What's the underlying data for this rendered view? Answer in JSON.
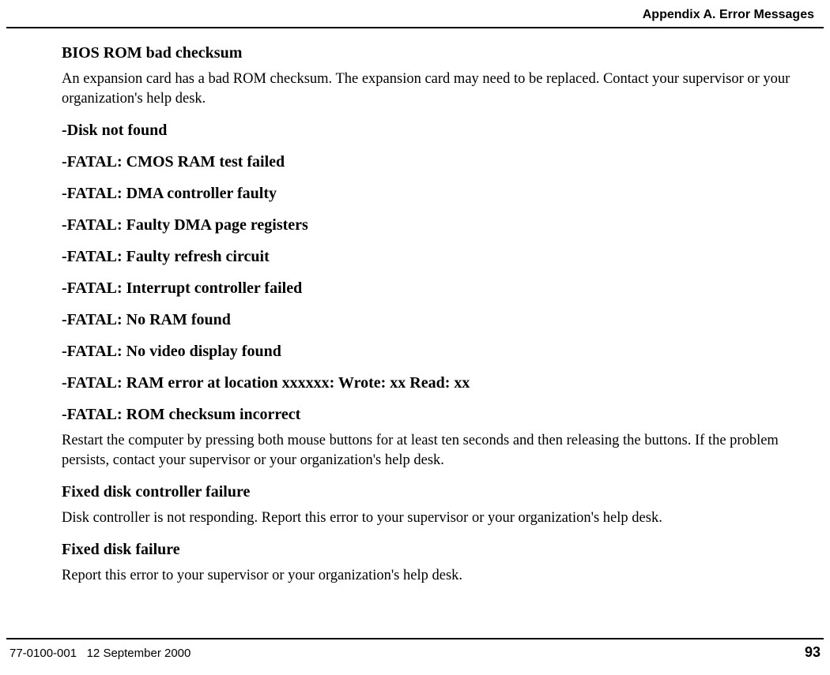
{
  "header": {
    "title": "Appendix A. Error Messages"
  },
  "sections": [
    {
      "heading": "BIOS ROM bad checksum",
      "body": "An expansion card has a bad ROM checksum. The expansion card may need to be replaced. Contact your supervisor or your organization's help desk."
    },
    {
      "heading": "-Disk not found"
    },
    {
      "heading": "-FATAL: CMOS RAM test failed"
    },
    {
      "heading": "-FATAL: DMA controller faulty"
    },
    {
      "heading": "-FATAL: Faulty DMA page registers"
    },
    {
      "heading": "-FATAL: Faulty refresh circuit"
    },
    {
      "heading": "-FATAL: Interrupt controller failed"
    },
    {
      "heading": "-FATAL: No RAM found"
    },
    {
      "heading": "-FATAL: No video display found"
    },
    {
      "heading": "-FATAL: RAM error at location xxxxxx: Wrote: xx Read: xx"
    },
    {
      "heading": "-FATAL: ROM checksum incorrect",
      "body": "Restart the computer by pressing both mouse buttons for at least ten seconds and then releasing the buttons. If the problem persists, contact your supervisor or your organization's help desk."
    },
    {
      "heading": "Fixed disk controller failure",
      "body": "Disk controller is not responding. Report this error to your supervisor or your organization's help desk."
    },
    {
      "heading": "Fixed disk failure",
      "body": "Report this error to your supervisor or your organization's help desk."
    }
  ],
  "footer": {
    "doc_id": "77-0100-001",
    "date": "12 September 2000",
    "page": "93"
  }
}
